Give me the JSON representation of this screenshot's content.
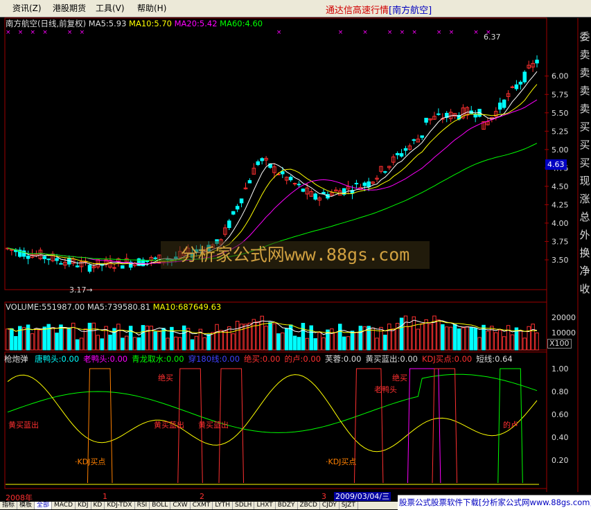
{
  "menu": {
    "items": [
      "资讯(Z)",
      "港股期货",
      "工具(V)",
      "帮助(H)"
    ],
    "title_prefix": "通达信高速行情",
    "title_stock": "[南方航空]"
  },
  "price_panel": {
    "stock_label": "南方航空(日线,前复权)",
    "ma5": "MA5:5.93",
    "ma10": "MA10:5.70",
    "ma20": "MA20:5.42",
    "ma60": "MA60:4.60",
    "high_label": "6.37",
    "low_label": "3.17",
    "current_price": "4.63",
    "y_ticks": [
      "6.00",
      "5.75",
      "5.50",
      "5.25",
      "5.00",
      "4.75",
      "4.50",
      "4.25",
      "4.00",
      "3.75",
      "3.50"
    ],
    "y_range": [
      3.17,
      6.45
    ]
  },
  "volume_panel": {
    "vol": "VOLUME:551987.00",
    "ma5": "MA5:739580.81",
    "ma10": "MA10:687649.63",
    "y_ticks": [
      "20000",
      "10000"
    ],
    "scale_label": "X100"
  },
  "indicator_panel": {
    "name": "枪炮弹",
    "items": [
      {
        "text": "唐鸭头:0.00",
        "color": "#00ffff"
      },
      {
        "text": "老鸭头:0.00",
        "color": "#ff00ff"
      },
      {
        "text": "青龙取水:0.00",
        "color": "#00ff00"
      },
      {
        "text": "穿180线:0.00",
        "color": "#4040ff"
      },
      {
        "text": "绝买:0.00",
        "color": "#ff3030"
      },
      {
        "text": "的卢:0.00",
        "color": "#ff3030"
      },
      {
        "text": "芙蓉:0.00",
        "color": "#dddddd"
      },
      {
        "text": "黄买蓝出:0.00",
        "color": "#dddddd"
      },
      {
        "text": "KDJ买点:0.00",
        "color": "#ff3030"
      },
      {
        "text": "短线:0.64",
        "color": "#dddddd"
      }
    ],
    "y_ticks": [
      "1.00",
      "0.80",
      "0.60",
      "0.40",
      "0.20"
    ],
    "annotations": [
      {
        "text": "黄买蓝出",
        "color": "#ff3030"
      },
      {
        "text": "绝买",
        "color": "#ff3030"
      },
      {
        "text": "黄买蓝出",
        "color": "#ff3030"
      },
      {
        "text": "黄买蓝出",
        "color": "#ff3030"
      },
      {
        "text": "绝买",
        "color": "#ff3030"
      },
      {
        "text": "老鸭头",
        "color": "#ff3030"
      },
      {
        "text": "的卢",
        "color": "#ff3030"
      },
      {
        "text": "·KDJ买点",
        "color": "#ff8000"
      },
      {
        "text": "·KDJ买点",
        "color": "#ff8000"
      }
    ]
  },
  "watermark": "分析家公式网www.88gs.com",
  "right_labels": [
    "委",
    "卖",
    "卖",
    "卖",
    "卖",
    "买",
    "买",
    "买",
    "现",
    "涨",
    "总",
    "外",
    "换",
    "净",
    "收"
  ],
  "right_axis_misc": [
    "14",
    "14",
    "14",
    "14",
    "14",
    "14",
    "14",
    "14",
    "14",
    "14",
    "14",
    "14",
    "15"
  ],
  "date_axis": {
    "labels": [
      "2008年",
      "1",
      "2",
      "3"
    ],
    "cursor_date": "2009/03/04/三"
  },
  "tabs": [
    "指标",
    "模板",
    "全部",
    "MACD",
    "KDJ",
    "KD",
    "KDJ-TDX",
    "RSI",
    "BOLL",
    "CXW",
    "CXMT",
    "LYTH",
    "SDLH",
    "LHXT",
    "BDZY",
    "ZBCD",
    "CJDY",
    "SJZT"
  ],
  "active_tab": "全部",
  "footer_ad": "股票公式股票软件下载[分析家公式网www.88gs.com]",
  "colors": {
    "up": "#ff3030",
    "down": "#00ffff",
    "ma5": "#ffffff",
    "ma10": "#ffff00",
    "ma20": "#ff00ff",
    "ma60": "#00ff00"
  }
}
